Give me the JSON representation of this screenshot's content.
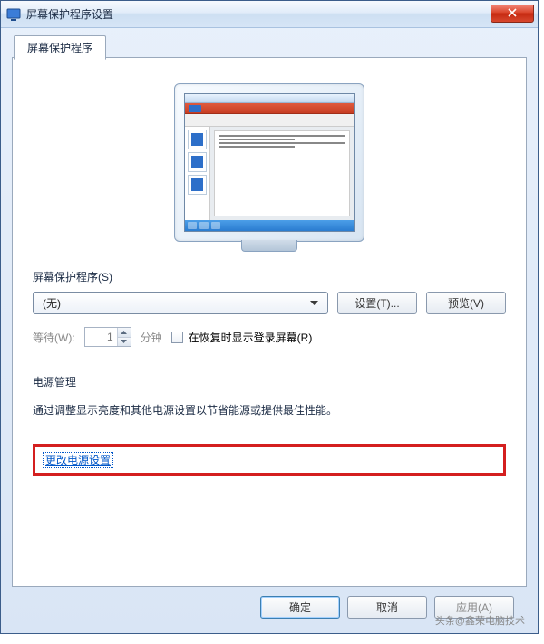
{
  "window": {
    "title": "屏幕保护程序设置"
  },
  "tab": {
    "label": "屏幕保护程序"
  },
  "screensaver": {
    "section_label": "屏幕保护程序(S)",
    "selected": "(无)",
    "settings_btn": "设置(T)...",
    "preview_btn": "预览(V)",
    "wait_label": "等待(W):",
    "wait_value": "1",
    "wait_unit": "分钟",
    "resume_checkbox": "在恢复时显示登录屏幕(R)"
  },
  "power": {
    "heading": "电源管理",
    "description": "通过调整显示亮度和其他电源设置以节省能源或提供最佳性能。",
    "link": "更改电源设置"
  },
  "footer": {
    "ok": "确定",
    "cancel": "取消",
    "apply": "应用(A)"
  },
  "watermark": "头条@鑫荣电脑技术"
}
